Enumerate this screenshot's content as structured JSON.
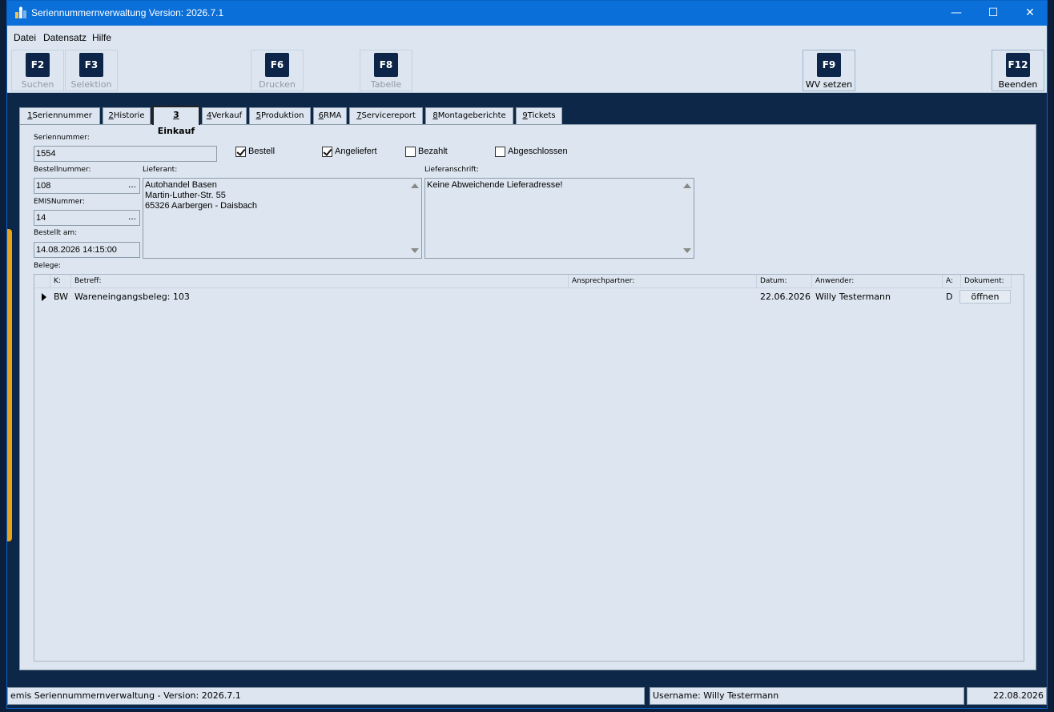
{
  "window": {
    "title": "Seriennummernverwaltung Version: 2026.7.1",
    "min": "—",
    "max": "☐",
    "close": "✕"
  },
  "menu": [
    {
      "label": "Datei"
    },
    {
      "label": "Datensatz"
    },
    {
      "label": "Hilfe"
    }
  ],
  "toolbar": [
    {
      "key": "F2",
      "label": "Suchen",
      "enabled": false
    },
    {
      "key": "F3",
      "label": "Selektion",
      "enabled": false
    },
    {
      "key": "F6",
      "label": "Drucken",
      "enabled": false
    },
    {
      "key": "F8",
      "label": "Tabelle",
      "enabled": false
    },
    {
      "key": "F9",
      "label": "WV setzen",
      "enabled": true
    },
    {
      "key": "F12",
      "label": "Beenden",
      "enabled": true
    }
  ],
  "tabs": [
    {
      "num": "1",
      "label": "Seriennummer"
    },
    {
      "num": "2",
      "label": "Historie"
    },
    {
      "num": "3",
      "label": "Einkauf",
      "active": true
    },
    {
      "num": "4",
      "label": "Verkauf"
    },
    {
      "num": "5",
      "label": "Produktion"
    },
    {
      "num": "6",
      "label": "RMA"
    },
    {
      "num": "7",
      "label": "Servicereport"
    },
    {
      "num": "8",
      "label": "Montageberichte"
    },
    {
      "num": "9",
      "label": "Tickets"
    }
  ],
  "form": {
    "seriennummer_label": "Seriennummer:",
    "seriennummer": "1554",
    "bestellnummer_label": "Bestellnummer:",
    "bestellnummer": "108",
    "emis_label": "EMISNummer:",
    "emis": "14",
    "bestellt_label": "Bestellt am:",
    "bestellt": "14.08.2026 14:15:00",
    "ellipsis": "...",
    "checks": [
      {
        "label": "Bestell",
        "checked": true
      },
      {
        "label": "Angeliefert",
        "checked": true
      },
      {
        "label": "Bezahlt",
        "checked": false
      },
      {
        "label": "Abgeschlossen",
        "checked": false
      }
    ],
    "lieferant_label": "Lieferant:",
    "lieferant": [
      "Autohandel Basen",
      "Martin-Luther-Str. 55",
      "65326 Aarbergen - Daisbach"
    ],
    "lieferanschrift_label": "Lieferanschrift:",
    "lieferanschrift": [
      "Keine Abweichende Lieferadresse!"
    ],
    "belege_label": "Belege:"
  },
  "grid": {
    "columns": [
      "K:",
      "Betreff:",
      "Ansprechpartner:",
      "Datum:",
      "Anwender:",
      "A:",
      "Dokument:"
    ],
    "rows": [
      {
        "k": "BW",
        "betreff": "Wareneingangsbeleg: 103",
        "ansprechpartner": "",
        "datum": "22.06.2026",
        "anwender": "Willy Testermann",
        "a": "D",
        "dokument": "öffnen"
      }
    ]
  },
  "status": {
    "app": "emis Seriennummernverwaltung - Version: 2026.7.1",
    "user": "Username: Willy Testermann",
    "date": "22.08.2026"
  },
  "colors": {
    "titlebar": "#0a6fd8",
    "background": "#0d2748",
    "panel": "#dde6f0",
    "accent": "#e8a317"
  }
}
